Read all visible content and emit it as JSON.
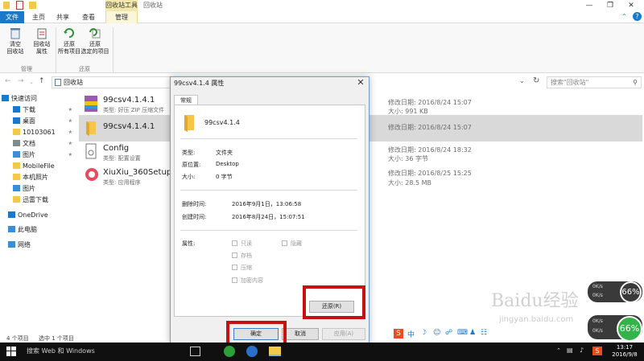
{
  "window": {
    "title": "回收站",
    "context_tab_header": "回收站工具",
    "help_glyph": "?"
  },
  "tabs": {
    "file": "文件",
    "home": "主页",
    "share": "共享",
    "view": "查看",
    "manage": "管理"
  },
  "ribbon": {
    "empty_bin": "清空\n回收站",
    "bin_props": "回收站\n属性",
    "restore_all": "还原\n所有项目",
    "restore_selected": "还原\n选定的项目",
    "group_manage": "管理",
    "group_restore": "还原"
  },
  "address": {
    "path": "回收站",
    "search_placeholder": "搜索\"回收站\""
  },
  "nav": [
    {
      "label": "快速访问",
      "icon": "star-icon",
      "pinned": false
    },
    {
      "label": "下载",
      "icon": "download-icon",
      "pinned": true
    },
    {
      "label": "桌面",
      "icon": "desktop-icon",
      "pinned": true
    },
    {
      "label": "10103061",
      "icon": "folder-icon",
      "pinned": true
    },
    {
      "label": "文档",
      "icon": "document-icon",
      "pinned": true
    },
    {
      "label": "图片",
      "icon": "picture-icon",
      "pinned": true
    },
    {
      "label": "MobileFile",
      "icon": "folder-icon",
      "pinned": false
    },
    {
      "label": "本机照片",
      "icon": "folder-icon",
      "pinned": false
    },
    {
      "label": "图片",
      "icon": "picture-icon",
      "pinned": false
    },
    {
      "label": "迅雷下载",
      "icon": "folder-icon",
      "pinned": false
    },
    {
      "label": "OneDrive",
      "icon": "cloud-icon",
      "pinned": false
    },
    {
      "label": "此电脑",
      "icon": "computer-icon",
      "pinned": false
    },
    {
      "label": "网络",
      "icon": "network-icon",
      "pinned": false
    }
  ],
  "files": [
    {
      "name": "99csv4.1.4.1",
      "sub": "类型: 好压 ZIP 压缩文件",
      "modified": "修改日期: 2016/8/24 15:07",
      "size": "大小: 991 KB"
    },
    {
      "name": "99csv4.1.4.1",
      "sub": "",
      "modified": "修改日期: 2016/8/24 15:07",
      "size": ""
    },
    {
      "name": "Config",
      "sub": "类型: 配置设置",
      "modified": "修改日期: 2016/8/24 18:32",
      "size": "大小: 36 字节"
    },
    {
      "name": "XiuXiu_360Setup_4.",
      "sub": "类型: 应用程序",
      "modified": "修改日期: 2016/8/25 15:25",
      "size": "大小: 28.5 MB"
    }
  ],
  "status": {
    "count": "4 个项目",
    "selected": "选中 1 个项目"
  },
  "dialog": {
    "title": "99csv4.1.4 属性",
    "tab": "常规",
    "name": "99csv4.1.4",
    "type_label": "类型:",
    "type_value": "文件夹",
    "location_label": "原位置:",
    "location_value": "Desktop",
    "size_label": "大小:",
    "size_value": "0 字节",
    "deleted_label": "删除时间:",
    "deleted_value": "2016年9月1日，13:06:58",
    "created_label": "创建时间:",
    "created_value": "2016年8月24日，15:07:51",
    "attrs_label": "属性:",
    "attr_readonly": "只读",
    "attr_hidden": "隐藏",
    "attr_archive": "存档",
    "attr_compress": "压缩",
    "attr_encrypt": "加密内容",
    "restore_btn": "还原(R)",
    "ok_btn": "确定",
    "cancel_btn": "取消",
    "apply_btn": "应用(A)"
  },
  "taskbar": {
    "search": "搜索 Web 和 Windows",
    "time": "13:17",
    "date": "2016/9/8"
  },
  "widgets": {
    "speed1_up": "0K/s",
    "speed1_down": "0K/s",
    "gauge1": "66%",
    "speed2_up": "0K/s",
    "speed2_down": "0K/s",
    "gauge2": "66%"
  },
  "watermark": {
    "main": "Baidu经验",
    "sub": "jingyan.baidu.com"
  },
  "colors": {
    "accent": "#1979ca",
    "highlight": "#c41213",
    "selection": "#d9d9d9",
    "gauge": "#34b34a"
  }
}
